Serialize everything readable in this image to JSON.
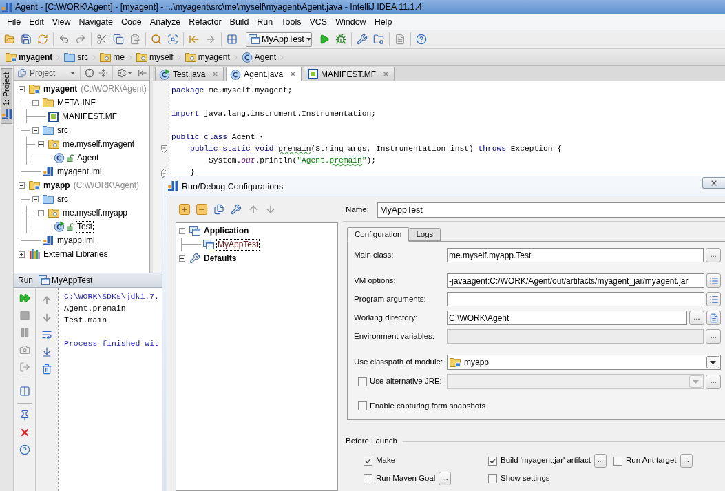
{
  "window": {
    "title": "Agent - [C:\\WORK\\Agent] - [myagent] - ...\\myagent\\src\\me\\myself\\myagent\\Agent.java - IntelliJ IDEA 11.1.4"
  },
  "menu": [
    "File",
    "Edit",
    "View",
    "Navigate",
    "Code",
    "Analyze",
    "Refactor",
    "Build",
    "Run",
    "Tools",
    "VCS",
    "Window",
    "Help"
  ],
  "toolbar": {
    "run_configuration": "MyAppTest"
  },
  "breadcrumbs": [
    {
      "label": "myagent",
      "kind": "module"
    },
    {
      "label": "src",
      "kind": "source_folder"
    },
    {
      "label": "me",
      "kind": "package"
    },
    {
      "label": "myself",
      "kind": "package"
    },
    {
      "label": "myagent",
      "kind": "package"
    },
    {
      "label": "Agent",
      "kind": "class"
    }
  ],
  "tool_windows": [
    {
      "label": "1: Project",
      "selected": true
    }
  ],
  "project_panel": {
    "view": "Project",
    "tree": [
      {
        "label": "myagent",
        "note": "(C:\\WORK\\Agent)",
        "kind": "module",
        "expanded": true,
        "selected": false,
        "children": [
          {
            "label": "META-INF",
            "kind": "folder",
            "expanded": true,
            "selected": false,
            "children": [
              {
                "label": "MANIFEST.MF",
                "kind": "manifest",
                "selected": false
              }
            ]
          },
          {
            "label": "src",
            "kind": "source_folder",
            "expanded": true,
            "selected": false,
            "children": [
              {
                "label": "me.myself.myagent",
                "kind": "package",
                "expanded": true,
                "selected": false,
                "children": [
                  {
                    "label": "Agent",
                    "kind": "class",
                    "selected": false
                  }
                ]
              }
            ]
          },
          {
            "label": "myagent.iml",
            "kind": "module_file",
            "selected": false
          }
        ]
      },
      {
        "label": "myapp",
        "note": "(C:\\WORK\\Agent)",
        "kind": "module",
        "expanded": true,
        "selected": false,
        "children": [
          {
            "label": "src",
            "kind": "source_folder",
            "expanded": true,
            "selected": false,
            "children": [
              {
                "label": "me.myself.myapp",
                "kind": "package",
                "expanded": true,
                "selected": false,
                "children": [
                  {
                    "label": "Test",
                    "kind": "runnable_class",
                    "selected": true
                  }
                ]
              }
            ]
          },
          {
            "label": "myapp.iml",
            "kind": "module_file",
            "selected": false
          }
        ]
      },
      {
        "label": "External Libraries",
        "kind": "libraries",
        "expanded": false,
        "selected": false
      }
    ]
  },
  "editor": {
    "tabs": [
      {
        "label": "Test.java",
        "kind": "runnable_class",
        "selected": false
      },
      {
        "label": "Agent.java",
        "kind": "class",
        "selected": true
      },
      {
        "label": "MANIFEST.MF",
        "kind": "manifest",
        "selected": false
      }
    ],
    "lines": [
      {
        "kind": "code",
        "tokens": [
          {
            "text": "package",
            "kind": "keyword"
          },
          {
            "text": " me.myself.myagent;",
            "kind": "plain"
          }
        ]
      },
      {
        "kind": "blank"
      },
      {
        "kind": "code",
        "tokens": [
          {
            "text": "import",
            "kind": "keyword"
          },
          {
            "text": " java.lang.instrument.Instrumentation;",
            "kind": "plain"
          }
        ]
      },
      {
        "kind": "blank"
      },
      {
        "kind": "code",
        "tokens": [
          {
            "text": "public class",
            "kind": "keyword"
          },
          {
            "text": " Agent {",
            "kind": "plain"
          }
        ]
      },
      {
        "kind": "code",
        "fold": {
          "kind": "start"
        },
        "tokens": [
          {
            "text": "    public static void ",
            "kind": "keyword"
          },
          {
            "text": "premain",
            "kind": "typo"
          },
          {
            "text": "(String args, Instrumentation inst) ",
            "kind": "plain"
          },
          {
            "text": "throws",
            "kind": "keyword"
          },
          {
            "text": " Exception {",
            "kind": "plain"
          }
        ]
      },
      {
        "kind": "code",
        "tokens": [
          {
            "text": "        System.",
            "kind": "plain"
          },
          {
            "text": "out",
            "kind": "static_field"
          },
          {
            "text": ".println(",
            "kind": "plain"
          },
          {
            "text": "\"Agent.",
            "kind": "string"
          },
          {
            "text": "premain",
            "kind": "string_typo"
          },
          {
            "text": "\"",
            "kind": "string"
          },
          {
            "text": ");",
            "kind": "plain"
          }
        ]
      },
      {
        "kind": "code",
        "fold": {
          "kind": "end"
        },
        "tokens": [
          {
            "text": "    }",
            "kind": "plain"
          }
        ]
      }
    ]
  },
  "run_panel": {
    "title": "Run",
    "tab": "MyAppTest",
    "console": [
      {
        "text": "C:\\WORK\\SDKs\\jdk1.7.",
        "kind": "system"
      },
      {
        "text": "Agent.premain",
        "kind": "output"
      },
      {
        "text": "Test.main",
        "kind": "output"
      },
      {
        "text": "Process finished wit",
        "kind": "exit"
      }
    ]
  },
  "dialog": {
    "title": "Run/Debug Configurations",
    "tree": [
      {
        "label": "Application",
        "kind": "config_type",
        "expanded": true,
        "selected": false,
        "children": [
          {
            "label": "MyAppTest",
            "kind": "configuration",
            "selected": true
          }
        ]
      },
      {
        "label": "Defaults",
        "kind": "defaults",
        "expanded": false,
        "selected": false
      }
    ],
    "name": {
      "label": "Name:",
      "value": "MyAppTest"
    },
    "tabs": [
      {
        "label": "Configuration",
        "selected": true
      },
      {
        "label": "Logs",
        "selected": false
      }
    ],
    "field_groups": [
      [
        {
          "label": "Main class:",
          "kind": "text",
          "value": "me.myself.myapp.Test",
          "disabled": false,
          "buttons": [
            {
              "kind": "browse",
              "label": "..."
            }
          ]
        }
      ],
      [
        {
          "label": "VM options:",
          "kind": "text",
          "value": "-javaagent:C:/WORK/Agent/out/artifacts/myagent_jar/myagent.jar",
          "disabled": false,
          "buttons": [
            {
              "kind": "expand"
            }
          ]
        },
        {
          "label": "Program arguments:",
          "kind": "text",
          "disabled": false,
          "buttons": [
            {
              "kind": "expand"
            }
          ]
        },
        {
          "label": "Working directory:",
          "kind": "text",
          "value": "C:\\WORK\\Agent",
          "disabled": false,
          "buttons": [
            {
              "kind": "browse",
              "label": "..."
            },
            {
              "kind": "macros"
            }
          ]
        },
        {
          "label": "Environment variables:",
          "kind": "text",
          "disabled": true,
          "buttons": [
            {
              "kind": "browse",
              "label": "..."
            }
          ]
        }
      ],
      [
        {
          "label": "Use classpath of module:",
          "kind": "combo",
          "value": "myapp",
          "disabled": false
        },
        {
          "label": "Use alternative JRE:",
          "kind": "checkbox_combo",
          "checked": false,
          "disabled": true,
          "buttons": [
            {
              "kind": "browse",
              "label": "..."
            }
          ]
        }
      ],
      [
        {
          "label": "Enable capturing form snapshots",
          "kind": "checkbox",
          "checked": false,
          "disabled": false
        }
      ]
    ],
    "before_launch": {
      "title": "Before Launch",
      "tasks": [
        {
          "label": "Make",
          "checked": true
        },
        {
          "label": "Build 'myagent:jar' artifact",
          "checked": true,
          "button": "..."
        },
        {
          "label": "Run Ant target",
          "checked": false,
          "button": "..."
        },
        {
          "label": "Run Maven Goal",
          "checked": false,
          "button": "..."
        },
        {
          "label": "Show settings",
          "checked": false
        }
      ]
    }
  }
}
